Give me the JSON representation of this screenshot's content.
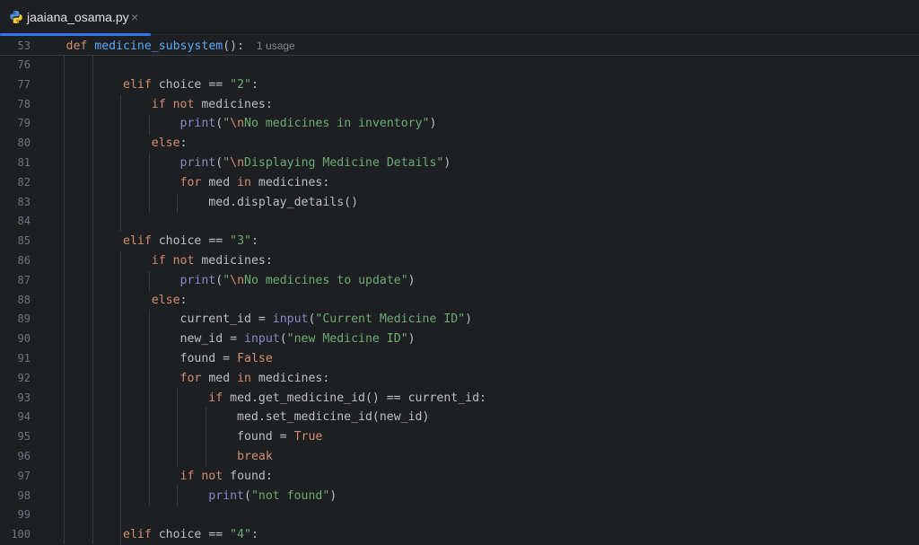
{
  "tab": {
    "filename": "jaaiana_osama.py",
    "icon": "python-file-icon",
    "close": "×"
  },
  "sticky": {
    "line_number": "53",
    "kw": "def",
    "fn": "medicine_subsystem",
    "rest": "():",
    "usage": "1 usage"
  },
  "lines": [
    {
      "n": "76",
      "tokens": []
    },
    {
      "n": "77",
      "tokens": [
        [
          "",
          "        "
        ],
        [
          "kw",
          "elif"
        ],
        [
          "",
          " choice == "
        ],
        [
          "str",
          "\"2\""
        ],
        [
          "",
          ":"
        ]
      ]
    },
    {
      "n": "78",
      "tokens": [
        [
          "",
          "            "
        ],
        [
          "kw",
          "if not"
        ],
        [
          "",
          " medicines:"
        ]
      ]
    },
    {
      "n": "79",
      "tokens": [
        [
          "",
          "                "
        ],
        [
          "bi",
          "print"
        ],
        [
          "",
          "("
        ],
        [
          "str",
          "\""
        ],
        [
          "esc",
          "\\n"
        ],
        [
          "str",
          "No medicines in inventory\""
        ],
        [
          "",
          ")"
        ]
      ]
    },
    {
      "n": "80",
      "tokens": [
        [
          "",
          "            "
        ],
        [
          "kw",
          "else"
        ],
        [
          "",
          ":"
        ]
      ]
    },
    {
      "n": "81",
      "tokens": [
        [
          "",
          "                "
        ],
        [
          "bi",
          "print"
        ],
        [
          "",
          "("
        ],
        [
          "str",
          "\""
        ],
        [
          "esc",
          "\\n"
        ],
        [
          "str",
          "Displaying Medicine Details\""
        ],
        [
          "",
          ")"
        ]
      ]
    },
    {
      "n": "82",
      "tokens": [
        [
          "",
          "                "
        ],
        [
          "kw",
          "for"
        ],
        [
          "",
          " med "
        ],
        [
          "kw",
          "in"
        ],
        [
          "",
          " medicines:"
        ]
      ]
    },
    {
      "n": "83",
      "tokens": [
        [
          "",
          "                    med.display_details()"
        ]
      ]
    },
    {
      "n": "84",
      "tokens": []
    },
    {
      "n": "85",
      "tokens": [
        [
          "",
          "        "
        ],
        [
          "kw",
          "elif"
        ],
        [
          "",
          " choice == "
        ],
        [
          "str",
          "\"3\""
        ],
        [
          "",
          ":"
        ]
      ]
    },
    {
      "n": "86",
      "tokens": [
        [
          "",
          "            "
        ],
        [
          "kw",
          "if not"
        ],
        [
          "",
          " medicines:"
        ]
      ]
    },
    {
      "n": "87",
      "tokens": [
        [
          "",
          "                "
        ],
        [
          "bi",
          "print"
        ],
        [
          "",
          "("
        ],
        [
          "str",
          "\""
        ],
        [
          "esc",
          "\\n"
        ],
        [
          "str",
          "No medicines to update\""
        ],
        [
          "",
          ")"
        ]
      ]
    },
    {
      "n": "88",
      "tokens": [
        [
          "",
          "            "
        ],
        [
          "kw",
          "else"
        ],
        [
          "",
          ":"
        ]
      ]
    },
    {
      "n": "89",
      "tokens": [
        [
          "",
          "                current_id = "
        ],
        [
          "bi",
          "input"
        ],
        [
          "",
          "("
        ],
        [
          "str",
          "\"Current Medicine ID\""
        ],
        [
          "",
          ")"
        ]
      ]
    },
    {
      "n": "90",
      "tokens": [
        [
          "",
          "                new_id = "
        ],
        [
          "bi",
          "input"
        ],
        [
          "",
          "("
        ],
        [
          "str",
          "\"new Medicine ID\""
        ],
        [
          "",
          ")"
        ]
      ]
    },
    {
      "n": "91",
      "tokens": [
        [
          "",
          "                found = "
        ],
        [
          "kw",
          "False"
        ]
      ]
    },
    {
      "n": "92",
      "tokens": [
        [
          "",
          "                "
        ],
        [
          "kw",
          "for"
        ],
        [
          "",
          " med "
        ],
        [
          "kw",
          "in"
        ],
        [
          "",
          " medicines:"
        ]
      ]
    },
    {
      "n": "93",
      "tokens": [
        [
          "",
          "                    "
        ],
        [
          "kw",
          "if"
        ],
        [
          "",
          " med.get_medicine_id() == current_id:"
        ]
      ]
    },
    {
      "n": "94",
      "tokens": [
        [
          "",
          "                        med.set_medicine_id(new_id)"
        ]
      ]
    },
    {
      "n": "95",
      "tokens": [
        [
          "",
          "                        found = "
        ],
        [
          "kw",
          "True"
        ]
      ]
    },
    {
      "n": "96",
      "tokens": [
        [
          "",
          "                        "
        ],
        [
          "kw",
          "break"
        ]
      ]
    },
    {
      "n": "97",
      "tokens": [
        [
          "",
          "                "
        ],
        [
          "kw",
          "if not"
        ],
        [
          "",
          " found:"
        ]
      ]
    },
    {
      "n": "98",
      "tokens": [
        [
          "",
          "                    "
        ],
        [
          "bi",
          "print"
        ],
        [
          "",
          "("
        ],
        [
          "str",
          "\"not found\""
        ],
        [
          "",
          ")"
        ]
      ]
    },
    {
      "n": "99",
      "tokens": []
    },
    {
      "n": "100",
      "tokens": [
        [
          "",
          "        "
        ],
        [
          "kw",
          "elif"
        ],
        [
          "",
          " choice == "
        ],
        [
          "str",
          "\"4\""
        ],
        [
          "",
          ":"
        ]
      ]
    }
  ],
  "colors": {
    "background": "#1e1f22",
    "keyword": "#cf8e6d",
    "string": "#6aab73",
    "builtin": "#8888c6",
    "function": "#56a8f5",
    "text": "#bcbec4",
    "line_number": "#6f737a",
    "accent": "#3574f0"
  }
}
